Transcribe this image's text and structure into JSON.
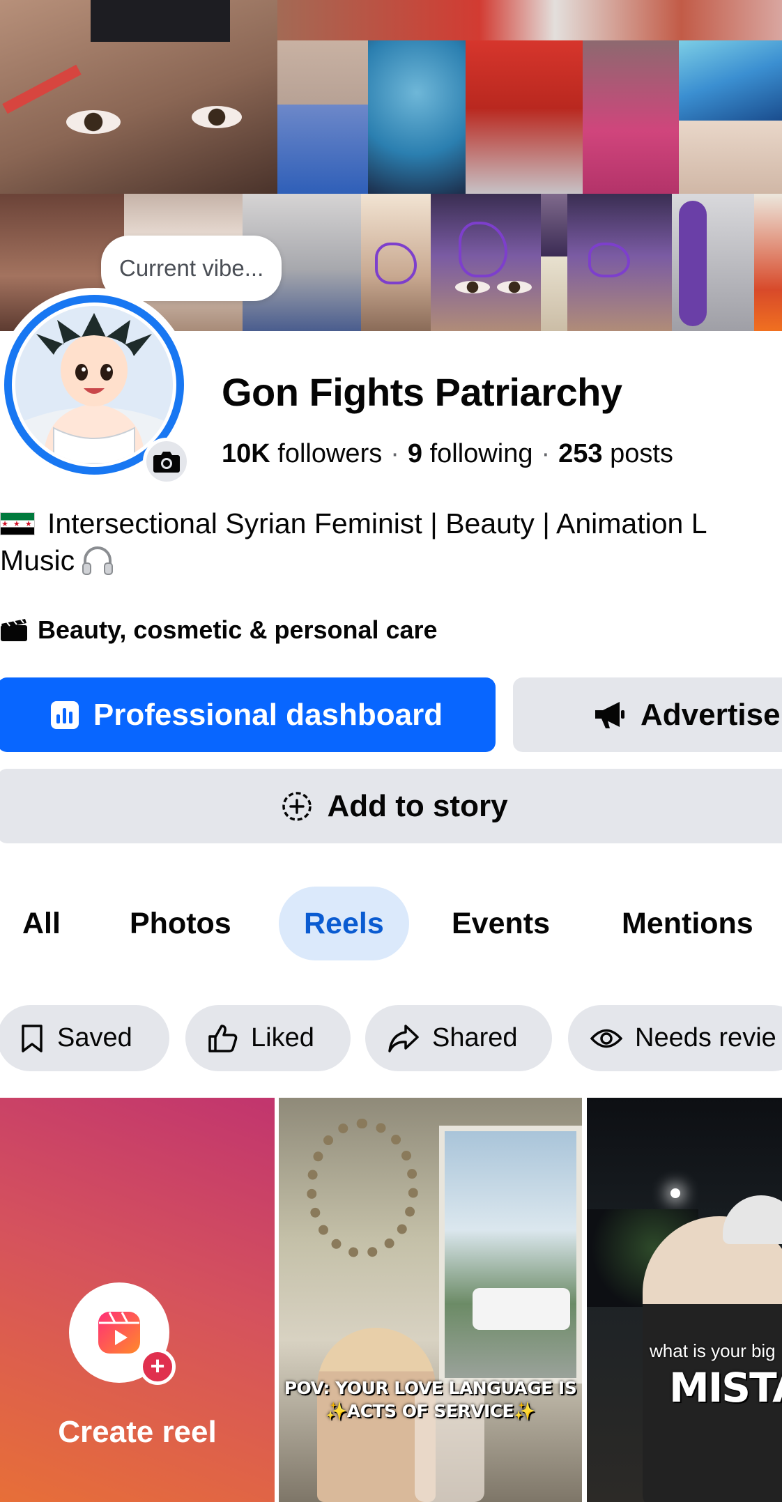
{
  "profile": {
    "vibe_prompt": "Current vibe...",
    "name": "Gon Fights Patriarchy",
    "followers_count": "10K",
    "followers_label": "followers",
    "following_count": "9",
    "following_label": "following",
    "posts_count": "253",
    "posts_label": "posts",
    "separator": "·",
    "bio_line1": "Intersectional Syrian Feminist | Beauty | Animation L",
    "bio_line2": "Music",
    "category": "Beauty, cosmetic & personal care"
  },
  "actions": {
    "professional_dashboard": "Professional dashboard",
    "advertise": "Advertise",
    "add_to_story": "Add to story"
  },
  "tabs": [
    {
      "label": "All",
      "active": false
    },
    {
      "label": "Photos",
      "active": false
    },
    {
      "label": "Reels",
      "active": true
    },
    {
      "label": "Events",
      "active": false
    },
    {
      "label": "Mentions",
      "active": false
    }
  ],
  "filters": [
    {
      "label": "Saved",
      "icon": "bookmark-icon"
    },
    {
      "label": "Liked",
      "icon": "thumbs-up-icon"
    },
    {
      "label": "Shared",
      "icon": "share-arrow-icon"
    },
    {
      "label": "Needs revie",
      "icon": "eye-icon"
    }
  ],
  "reels": {
    "create_label": "Create reel",
    "reel2_caption_line1": "POV: YOUR LOVE LANGUAGE IS",
    "reel2_caption_line2": "✨ACTS OF SERVICE✨",
    "reel3_caption_small": "what is your big",
    "reel3_caption_big": "MISTAKE"
  },
  "colors": {
    "primary_blue": "#0866ff",
    "active_tab_bg": "#dbe9fb",
    "active_tab_text": "#0a5bd1",
    "button_gray": "#e4e6eb"
  }
}
